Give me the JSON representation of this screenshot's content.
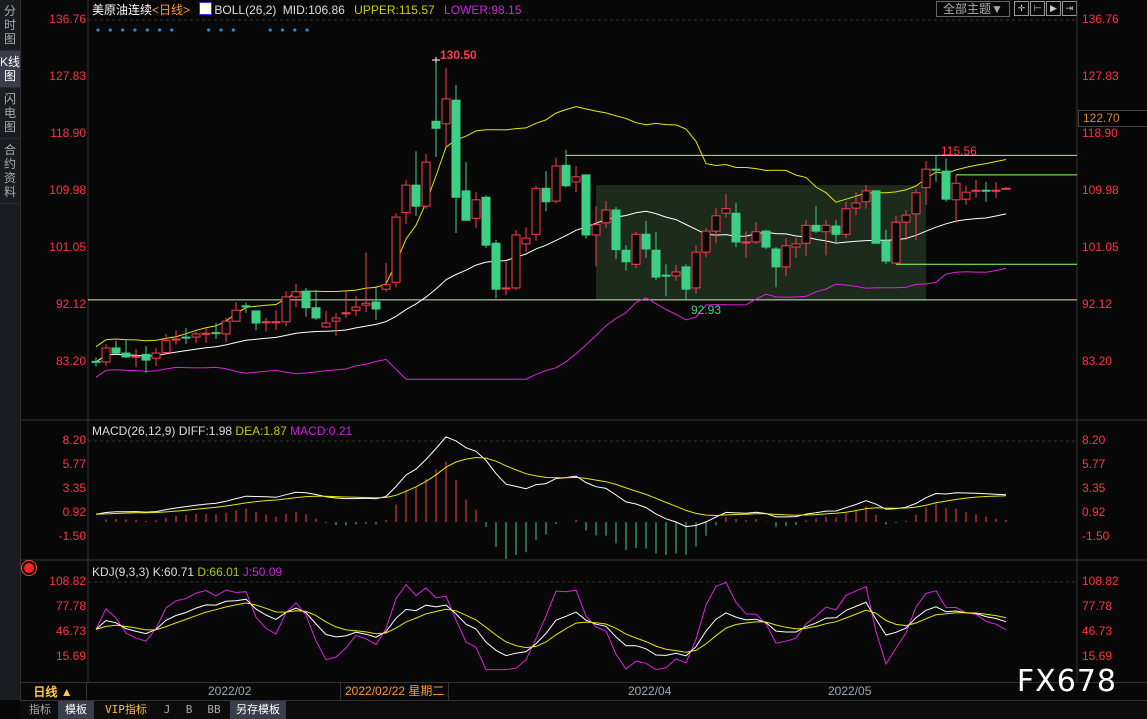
{
  "sidebar": {
    "tabs": [
      {
        "label": "分时图",
        "active": false
      },
      {
        "label": "K线图",
        "active": true
      },
      {
        "label": "闪电图",
        "active": false
      },
      {
        "label": "合约资料",
        "active": false
      }
    ]
  },
  "header": {
    "symbol": "美原油连续",
    "period": "<日线>",
    "indicator": "BOLL(26,2)",
    "mid": "MID:106.86",
    "upper": "UPPER:115.57",
    "lower": "LOWER:98.15",
    "theme_button": "全部主题▼",
    "toolbar_icons": [
      "crosshair-icon",
      "zoom-left-icon",
      "play-icon",
      "shift-right-icon"
    ]
  },
  "price_axis": {
    "labels": [
      "136.76",
      "127.83",
      "118.90",
      "109.98",
      "101.05",
      "92.12",
      "83.20"
    ],
    "cursor_price": "122.70"
  },
  "annotations": {
    "high": "130.50",
    "low": "92.93",
    "recent_high": "115.56"
  },
  "macd": {
    "title": "MACD(26,12,9)",
    "diff": "DIFF:1.98",
    "dea": "DEA:1.87",
    "macd": "MACD:0.21",
    "labels": [
      "8.20",
      "5.77",
      "3.35",
      "0.92",
      "-1.50"
    ]
  },
  "kdj": {
    "title": "KDJ(9,3,3)",
    "k": "K:60.71",
    "d": "D:66.01",
    "j": "J:50.09",
    "labels": [
      "108.82",
      "77.78",
      "46.73",
      "15.69"
    ]
  },
  "datebar": {
    "period_button": "日线 ▲",
    "dates": [
      "2022/02",
      "2022/02/22 星期二",
      "2022/04",
      "2022/05"
    ]
  },
  "bottom_tabs": [
    "指标",
    "模板",
    "VIP指标",
    "J",
    "B",
    "BB",
    "另存模板"
  ],
  "watermark": "FX678",
  "colors": {
    "up": "#ff3b4e",
    "down": "#3ecf86",
    "mid": "#ffffff",
    "upper": "#e6e600",
    "lower": "#dd22dd",
    "level": "#99ff66",
    "axis": "#ff3344"
  },
  "chart_data": {
    "type": "candlestick",
    "title": "美原油连续 日线",
    "ylim": [
      83.2,
      136.76
    ],
    "ohlc": [
      [
        83.3,
        83.9,
        82.5,
        83.2
      ],
      [
        83.2,
        86.0,
        82.6,
        85.4
      ],
      [
        85.4,
        86.5,
        84.6,
        84.6
      ],
      [
        84.6,
        86.6,
        83.8,
        84.0
      ],
      [
        84.0,
        85.2,
        82.4,
        84.1
      ],
      [
        84.4,
        85.7,
        81.5,
        83.5
      ],
      [
        83.8,
        85.4,
        82.6,
        84.6
      ],
      [
        84.7,
        87.6,
        84.6,
        86.6
      ],
      [
        86.7,
        88.2,
        85.9,
        86.8
      ],
      [
        87.1,
        88.5,
        86.0,
        87.0
      ],
      [
        87.1,
        88.0,
        86.2,
        87.6
      ],
      [
        87.6,
        88.5,
        86.2,
        87.7
      ],
      [
        87.8,
        89.3,
        86.8,
        87.7
      ],
      [
        87.6,
        90.1,
        86.3,
        89.6
      ],
      [
        89.6,
        92.6,
        89.5,
        91.3
      ],
      [
        92.0,
        92.5,
        90.9,
        91.9
      ],
      [
        91.2,
        91.3,
        88.2,
        89.3
      ],
      [
        89.4,
        90.1,
        88.0,
        89.5
      ],
      [
        89.4,
        91.3,
        88.2,
        89.5
      ],
      [
        89.5,
        94.3,
        88.8,
        93.4
      ],
      [
        93.4,
        95.4,
        91.8,
        94.2
      ],
      [
        94.3,
        94.8,
        90.3,
        91.7
      ],
      [
        91.7,
        94.5,
        89.8,
        90.1
      ],
      [
        88.7,
        91.2,
        88.5,
        89.3
      ],
      [
        89.6,
        90.9,
        87.3,
        90.1
      ],
      [
        90.8,
        94.5,
        90.1,
        90.9
      ],
      [
        91.3,
        93.5,
        90.4,
        91.8
      ],
      [
        92.1,
        100.3,
        91.0,
        92.4
      ],
      [
        92.6,
        95.1,
        89.8,
        91.5
      ],
      [
        94.6,
        98.7,
        94.2,
        95.3
      ],
      [
        95.7,
        106.5,
        94.9,
        105.9
      ],
      [
        106.6,
        111.7,
        104.8,
        110.9
      ],
      [
        110.9,
        116.2,
        106.1,
        107.6
      ],
      [
        107.6,
        115.8,
        107.2,
        114.5
      ],
      [
        120.9,
        130.5,
        115.3,
        119.8
      ],
      [
        120.5,
        129.2,
        116.9,
        124.4
      ],
      [
        124.2,
        126.6,
        103.4,
        109.0
      ],
      [
        110.0,
        114.5,
        105.3,
        105.4
      ],
      [
        105.7,
        109.8,
        104.2,
        108.6
      ],
      [
        109.0,
        109.3,
        101.1,
        101.5
      ],
      [
        101.8,
        102.3,
        93.2,
        94.6
      ],
      [
        94.7,
        98.9,
        93.7,
        94.8
      ],
      [
        94.8,
        103.9,
        94.5,
        103.1
      ],
      [
        101.7,
        104.3,
        100.4,
        102.6
      ],
      [
        103.2,
        110.8,
        102.2,
        110.4
      ],
      [
        110.4,
        113.1,
        106.8,
        108.3
      ],
      [
        108.4,
        115.2,
        108.1,
        113.9
      ],
      [
        114.0,
        116.4,
        110.5,
        110.8
      ],
      [
        111.4,
        113.9,
        109.8,
        112.2
      ],
      [
        112.5,
        112.6,
        102.5,
        103.1
      ],
      [
        103.1,
        107.6,
        98.2,
        104.7
      ],
      [
        105.0,
        108.4,
        104.2,
        107.0
      ],
      [
        107.0,
        107.5,
        99.3,
        100.8
      ],
      [
        100.7,
        101.5,
        97.5,
        98.9
      ],
      [
        98.5,
        103.6,
        97.9,
        103.2
      ],
      [
        103.2,
        105.3,
        99.5,
        100.9
      ],
      [
        100.7,
        103.6,
        96.0,
        96.5
      ],
      [
        96.8,
        98.5,
        93.5,
        96.7
      ],
      [
        96.7,
        98.4,
        95.9,
        97.3
      ],
      [
        98.1,
        98.5,
        92.93,
        94.6
      ],
      [
        94.8,
        101.5,
        93.9,
        100.4
      ],
      [
        100.4,
        104.2,
        99.6,
        103.7
      ],
      [
        103.7,
        107.3,
        101.8,
        106.1
      ],
      [
        106.5,
        109.5,
        105.8,
        107.2
      ],
      [
        106.5,
        108.1,
        101.2,
        102.0
      ],
      [
        101.9,
        103.7,
        99.5,
        102.0
      ],
      [
        102.0,
        105.1,
        101.7,
        103.6
      ],
      [
        103.7,
        103.9,
        100.9,
        101.2
      ],
      [
        100.9,
        101.2,
        94.9,
        98.1
      ],
      [
        98.1,
        102.6,
        96.7,
        101.4
      ],
      [
        101.2,
        102.6,
        99.5,
        101.7
      ],
      [
        101.8,
        105.4,
        99.8,
        104.6
      ],
      [
        104.6,
        107.6,
        103.4,
        103.7
      ],
      [
        103.6,
        105.4,
        99.9,
        104.6
      ],
      [
        104.5,
        105.4,
        102.0,
        103.2
      ],
      [
        103.2,
        108.3,
        102.6,
        107.2
      ],
      [
        107.3,
        109.8,
        106.2,
        108.1
      ],
      [
        108.3,
        110.9,
        107.2,
        110.0
      ],
      [
        110.0,
        110.1,
        101.8,
        101.8
      ],
      [
        102.1,
        103.9,
        98.5,
        99.0
      ],
      [
        98.7,
        106.1,
        98.5,
        105.1
      ],
      [
        105.1,
        107.0,
        102.3,
        106.2
      ],
      [
        106.4,
        110.3,
        102.3,
        109.7
      ],
      [
        110.5,
        114.7,
        107.8,
        113.4
      ],
      [
        113.4,
        115.56,
        111.4,
        113.3
      ],
      [
        113.1,
        115.1,
        108.3,
        108.7
      ],
      [
        108.6,
        112.5,
        105.0,
        111.2
      ],
      [
        108.7,
        110.8,
        107.8,
        109.8
      ],
      [
        110.0,
        111.7,
        108.9,
        110.1
      ],
      [
        110.1,
        111.4,
        108.3,
        110.0
      ],
      [
        110.0,
        111.4,
        108.9,
        110.1
      ],
      [
        110.3,
        110.6,
        110.2,
        110.4
      ]
    ],
    "levels": {
      "support_low": 92.93,
      "resistance": 115.56,
      "box_top": 110.9,
      "box_bottom": 92.93,
      "recent_top": 112.5,
      "recent_bottom": 98.5
    },
    "box_range_candles": [
      50,
      83
    ],
    "boll": {
      "period": 26,
      "k": 2
    },
    "macd_params": {
      "short": 12,
      "long": 26,
      "signal": 9
    },
    "macd_ylim": [
      -1.5,
      8.2
    ],
    "kdj_params": {
      "n": 9,
      "m1": 3,
      "m2": 3
    },
    "kdj_ylim": [
      15.69,
      108.82
    ]
  }
}
